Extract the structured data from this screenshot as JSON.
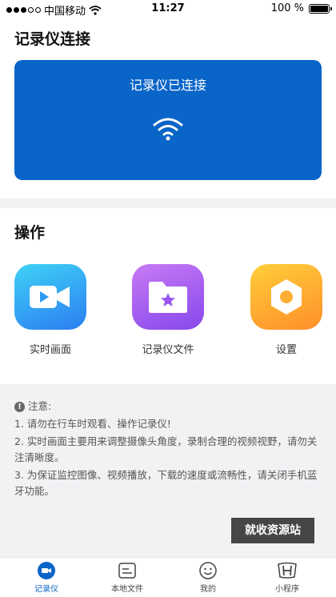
{
  "status_bar": {
    "carrier": "中国移动",
    "time": "11:27",
    "battery": "100 %",
    "battery_level": 1.0
  },
  "recorder_section": {
    "title": "记录仪连接",
    "status_text": "记录仪已连接",
    "card_color": "#0a65c8",
    "icon": "wifi-icon"
  },
  "operations_section": {
    "title": "操作",
    "items": [
      {
        "label": "实时画面",
        "icon": "video-camera-icon",
        "color": "#2b7df2"
      },
      {
        "label": "记录仪文件",
        "icon": "star-folder-icon",
        "color": "#8747ec"
      },
      {
        "label": "设置",
        "icon": "gear-icon",
        "color": "#ff8f2a"
      }
    ]
  },
  "notice": {
    "title": "注意:",
    "lines": [
      "1. 请勿在行车时观看、操作记录仪!",
      "2. 实时画面主要用来调整摄像头角度，录制合理的视频视野，请勿关注清晰度。",
      "3. 为保证监控图像、视频播放，下载的速度或流畅性，请关闭手机蓝牙功能。"
    ]
  },
  "watermark": "就收资源站",
  "tabbar": {
    "active_color": "#0a65c8",
    "items": [
      {
        "label": "记录仪",
        "icon": "camera-circle-icon",
        "active": true
      },
      {
        "label": "本地文件",
        "icon": "file-card-icon",
        "active": false
      },
      {
        "label": "我的",
        "icon": "smiley-icon",
        "active": false
      },
      {
        "label": "小程序",
        "icon": "honda-logo-icon",
        "active": false
      }
    ]
  }
}
